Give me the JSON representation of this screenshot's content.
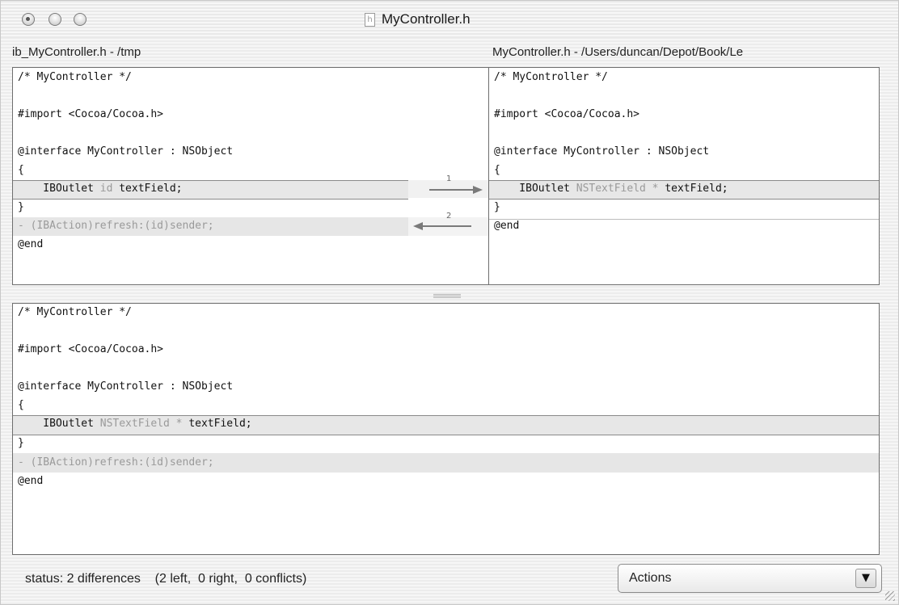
{
  "window": {
    "title": "MyController.h",
    "file_icon_glyph": "h"
  },
  "paths": {
    "left": "ib_MyController.h - /tmp",
    "right": "MyController.h - /Users/duncan/Depot/Book/Le"
  },
  "left_pane": {
    "lines": {
      "l1": "/* MyController */",
      "l2": "#import <Cocoa/Cocoa.h>",
      "l3": "@interface MyController : NSObject",
      "l4": "{",
      "l5a": "    IBOutlet ",
      "l5b": "id",
      "l5c": " textField;",
      "l6": "}",
      "l7": "- (IBAction)refresh:(id)sender;",
      "l8": "@end"
    }
  },
  "right_pane": {
    "lines": {
      "l1": "/* MyController */",
      "l2": "#import <Cocoa/Cocoa.h>",
      "l3": "@interface MyController : NSObject",
      "l4": "{",
      "l5a": "    IBOutlet ",
      "l5b": "NSTextField * ",
      "l5c": "textField;",
      "l6": "}",
      "l7": "@end"
    }
  },
  "merge_pane": {
    "lines": {
      "l1": "/* MyController */",
      "l2": "#import <Cocoa/Cocoa.h>",
      "l3": "@interface MyController : NSObject",
      "l4": "{",
      "l5a": "    IBOutlet ",
      "l5b": "NSTextField * ",
      "l5c": "textField;",
      "l6": "}",
      "l7": "- (IBAction)refresh:(id)sender;",
      "l8": "@end"
    }
  },
  "differences": [
    {
      "number": "1",
      "direction": "right"
    },
    {
      "number": "2",
      "direction": "left"
    }
  ],
  "status": {
    "text": "status: 2 differences    (2 left,  0 right,  0 conflicts)"
  },
  "actions_menu": {
    "label": "Actions",
    "arrow_glyph": "▼"
  }
}
